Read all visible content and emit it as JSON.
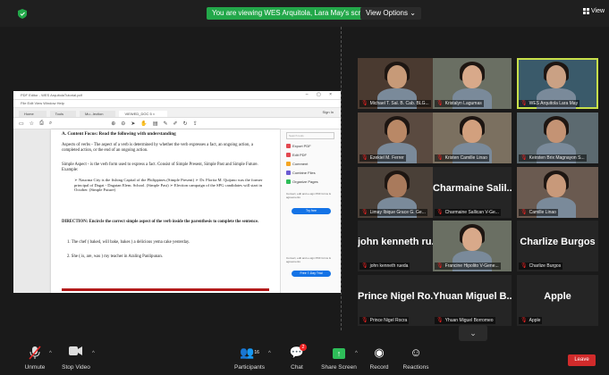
{
  "banner": {
    "viewing_text": "You are viewing WES Arquitola, Lara May's screen",
    "view_options_label": "View Options ⌄",
    "view_label": "View"
  },
  "shared_doc": {
    "window_title": "PDF Editor - WES ArquitolaTutorial.pdf",
    "menu_text": "File Edit View Window Help",
    "tabs": [
      "Home",
      "Tools",
      "Mu...lection",
      "VIEWED_DOC 5 ×"
    ],
    "sign_in": "Sign In",
    "content": {
      "heading": "A. Content Focus: Read the following with understanding",
      "aspects": "Aspects of verbs - The aspect of a verb is determined by whether the verb expresses a fact, an ongoing action, a completed action, or the end of an ongoing action.",
      "simple_aspect": "Simple Aspect - is the verb form used to express a fact. Consist of Simple Present, Simple Past and Simple Future. Example:",
      "examples": "➢ Naucma City is the fishing Capital of the Philippines.(Simple Present)  ➢ Dr. Florita M. Quijano was the former principal of Dagat - Dagatan Elem. School. (Simple Past)  ➢ Election campaign of the SPG candidates will start in October. (Simple Future)",
      "direction": "DIRECTION: Encircle the correct simple aspect of the verb inside the parenthesis to complete the sentence.",
      "item1": "1. The chef ( baked, will bake, bakes ) a delicious yema cake yesterday.",
      "item2": "2. She ( is, are, was ) my teacher in Araling Panlipunan."
    },
    "pane": {
      "search_placeholder": "Search tools",
      "items": [
        "Export PDF",
        "Edit PDF",
        "Comment",
        "Combine Files",
        "Organize Pages"
      ],
      "promo": "Convert, edit and e-sign PDF forms & agreements",
      "try_button": "Try free",
      "promo2": "Convert, edit and e-sign PDF forms & agreements",
      "free_trial_button": "Free 7-Day Trial"
    }
  },
  "participants": [
    {
      "label": "Michael T. Sal. B. Cab. BLG...",
      "kind": "video"
    },
    {
      "label": "Kristalyn Lagumas",
      "kind": "video"
    },
    {
      "label": "WES Arquitola Lara May",
      "kind": "video",
      "active": true
    },
    {
      "label": "Ezekiel M. Ferrer",
      "kind": "video"
    },
    {
      "label": "Kristen Camille Linao",
      "kind": "video"
    },
    {
      "label": "Keirsten Brix Magnayon S...",
      "kind": "video"
    },
    {
      "label": "Limay Ibique Grace G. Ge...",
      "kind": "video"
    },
    {
      "label": "Charmaine Sallican V-Ge...",
      "kind": "name",
      "big": "Charmaine Salil..."
    },
    {
      "label": "Camille Linao",
      "kind": "video"
    },
    {
      "label": "john kenneth rueda",
      "kind": "name",
      "big": "john kenneth ru..."
    },
    {
      "label": "Francine Hipolito V-Gene...",
      "kind": "video"
    },
    {
      "label": "Charlize Burgos",
      "kind": "name",
      "big": "Charlize Burgos"
    },
    {
      "label": "Prince Nigel Rocra",
      "kind": "name",
      "big": "Prince Nigel Ro..."
    },
    {
      "label": "Yhuan Miguel Borromeo",
      "kind": "name",
      "big": "Yhuan Miguel B..."
    },
    {
      "label": "Apple",
      "kind": "name",
      "big": "Apple"
    }
  ],
  "toolbar": {
    "unmute": "Unmute",
    "stop_video": "Stop Video",
    "participants": "Participants",
    "participants_count": "16",
    "chat": "Chat",
    "chat_badge": "2",
    "share_screen": "Share Screen",
    "record": "Record",
    "reactions": "Reactions",
    "leave": "Leave"
  },
  "colors": {
    "share_green": "#23a84a",
    "leave_red": "#d12b2b",
    "active_speaker": "#c8e04a"
  }
}
